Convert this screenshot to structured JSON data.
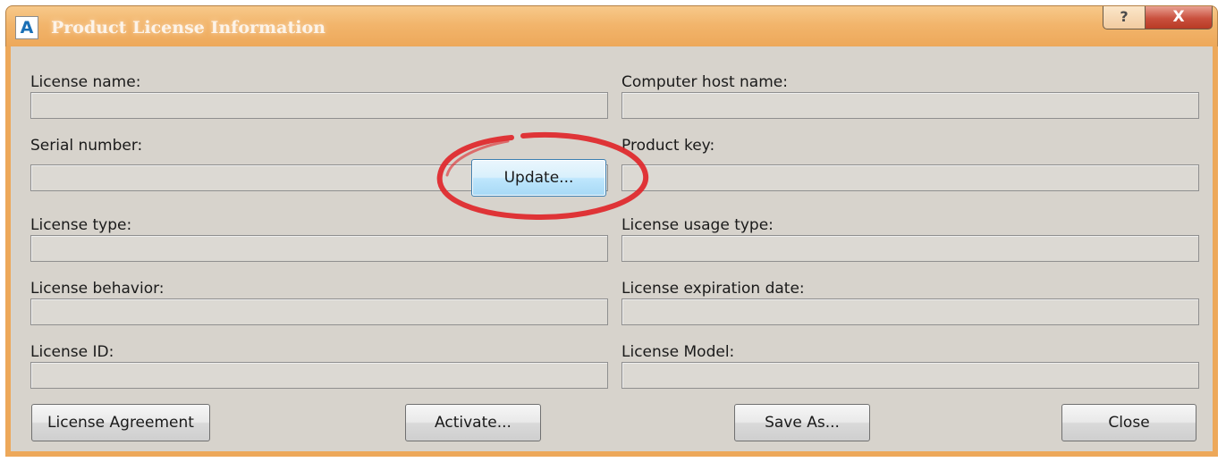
{
  "window": {
    "title": "Product License Information",
    "icon_letter": "A",
    "help_glyph": "?",
    "close_glyph": "X"
  },
  "fields": {
    "license_name": {
      "label": "License name:",
      "value": ""
    },
    "computer_host_name": {
      "label": "Computer host name:",
      "value": ""
    },
    "serial_number": {
      "label": "Serial number:",
      "value": ""
    },
    "product_key": {
      "label": "Product key:",
      "value": ""
    },
    "license_type": {
      "label": "License type:",
      "value": ""
    },
    "license_usage_type": {
      "label": "License usage type:",
      "value": ""
    },
    "license_behavior": {
      "label": "License behavior:",
      "value": ""
    },
    "license_expiration_date": {
      "label": "License expiration date:",
      "value": ""
    },
    "license_id": {
      "label": "License ID:",
      "value": ""
    },
    "license_model": {
      "label": "License Model:",
      "value": ""
    }
  },
  "buttons": {
    "update": "Update...",
    "license_agreement": "License Agreement",
    "activate": "Activate...",
    "save_as": "Save As...",
    "close": "Close"
  },
  "colors": {
    "title_bar": "#eda85a",
    "dialog_bg": "#d7d3cc",
    "annotation_circle": "#e0262a",
    "focused_button": "#3c7fb1"
  }
}
